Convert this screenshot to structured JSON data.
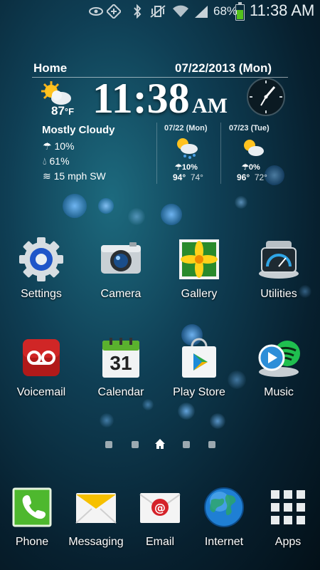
{
  "status_bar": {
    "battery_percent": "68%",
    "time": "11:38 AM",
    "icons": [
      "eye-icon",
      "nfc-icon",
      "bluetooth-icon",
      "vibrate-off-icon",
      "wifi-icon",
      "signal-icon",
      "battery-icon"
    ]
  },
  "clock_widget": {
    "location": "Home",
    "date": "07/22/2013 (Mon)",
    "time": "11:38",
    "ampm": "AM",
    "current_temp": "87",
    "temp_unit": "°F",
    "condition": "Mostly Cloudy",
    "precip": "10%",
    "humidity": "61%",
    "wind": "15 mph SW",
    "forecast": [
      {
        "date": "07/22 (Mon)",
        "precip": "10%",
        "high": "94°",
        "low": "74°"
      },
      {
        "date": "07/23 (Tue)",
        "precip": "0%",
        "high": "96°",
        "low": "72°"
      }
    ]
  },
  "apps": [
    {
      "label": "Settings"
    },
    {
      "label": "Camera"
    },
    {
      "label": "Gallery"
    },
    {
      "label": "Utilities"
    },
    {
      "label": "Voicemail"
    },
    {
      "label": "Calendar",
      "day": "31"
    },
    {
      "label": "Play Store"
    },
    {
      "label": "Music"
    }
  ],
  "dock": [
    {
      "label": "Phone"
    },
    {
      "label": "Messaging"
    },
    {
      "label": "Email"
    },
    {
      "label": "Internet"
    },
    {
      "label": "Apps"
    }
  ],
  "page_indicator": {
    "pages": 5,
    "current": 3
  }
}
